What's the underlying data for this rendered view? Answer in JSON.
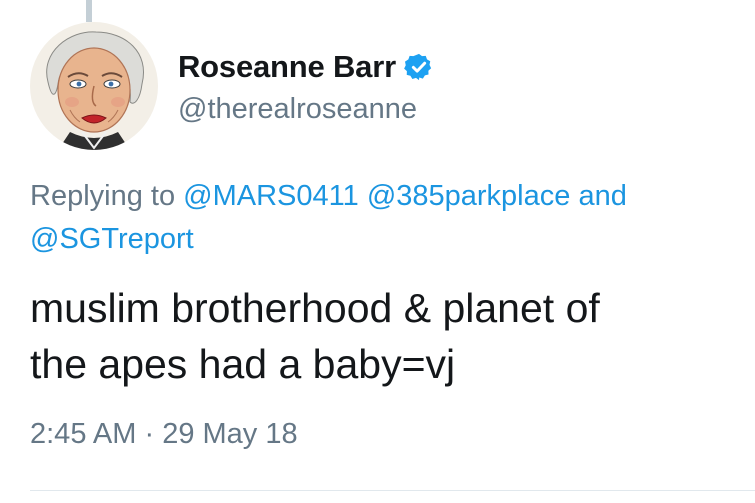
{
  "tweet": {
    "display_name": "Roseanne Barr",
    "handle": "@therealroseanne",
    "replying_prefix": "Replying to",
    "mentions": [
      "@MARS0411",
      "@385parkplace",
      "@SGTreport"
    ],
    "replying_conjunction": "and",
    "text_line1": "muslim brotherhood & planet of",
    "text_line2": "the apes had a baby=vj",
    "time": "2:45 AM",
    "separator": "·",
    "date": "29 May 18"
  },
  "icons": {
    "avatar": "avatar-portrait",
    "verified": "verified-badge-icon"
  },
  "colors": {
    "name": "#14171a",
    "secondary": "#657786",
    "link": "#1b95e0",
    "verified": "#1da1f2"
  }
}
